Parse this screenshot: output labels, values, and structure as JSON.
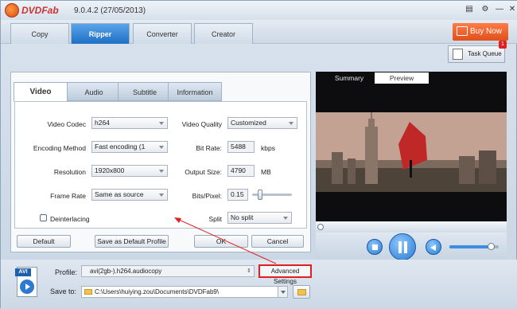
{
  "app": {
    "logo": "DVDFab",
    "version": "9.0.4.2 (27/05/2013)"
  },
  "titlebar_icons": [
    "layout-icon",
    "gear-icon",
    "minimize-icon",
    "close-icon"
  ],
  "nav": {
    "tabs": [
      {
        "label": "Copy",
        "active": false
      },
      {
        "label": "Ripper",
        "active": true
      },
      {
        "label": "Converter",
        "active": false
      },
      {
        "label": "Creator",
        "active": false
      }
    ],
    "buy_now": "Buy Now",
    "task_queue": "Task Queue",
    "task_badge": "1"
  },
  "settings": {
    "tabs": [
      "Video",
      "Audio",
      "Subtitle",
      "Information"
    ],
    "active_tab": "Video",
    "video_codec": {
      "label": "Video Codec",
      "value": "h264"
    },
    "encoding_method": {
      "label": "Encoding Method",
      "value": "Fast encoding (1"
    },
    "resolution": {
      "label": "Resolution",
      "value": "1920x800"
    },
    "frame_rate": {
      "label": "Frame Rate",
      "value": "Same as source"
    },
    "video_quality": {
      "label": "Video Quality",
      "value": "Customized"
    },
    "bit_rate": {
      "label": "Bit Rate:",
      "value": "5488",
      "unit": "kbps"
    },
    "output_size": {
      "label": "Output Size:",
      "value": "4790",
      "unit": "MB"
    },
    "bits_pixel": {
      "label": "Bits/Pixel:",
      "value": "0.15",
      "slider_level": 0.15
    },
    "deinterlacing": {
      "label": "Deinterlacing",
      "checked": false
    },
    "split": {
      "label": "Split",
      "value": "No split"
    },
    "buttons": {
      "default": "Default",
      "save_default": "Save as Default Profile",
      "ok": "OK",
      "cancel": "Cancel"
    }
  },
  "preview": {
    "tabs": [
      "Summary",
      "Preview"
    ],
    "active_tab": "Preview",
    "volume_level": 0.85
  },
  "bottom": {
    "profile_label": "Profile:",
    "profile_value": "avi(2gb-).h264.audiocopy",
    "advanced_settings": "Advanced Settings",
    "save_to_label": "Save to:",
    "save_to_value": "C:\\Users\\huiying.zou\\Documents\\DVDFab9\\",
    "format_icon_text": "AVI"
  },
  "colors": {
    "accent_blue": "#1e6fc6",
    "buy_orange": "#e0501c",
    "highlight_red": "#e02020"
  }
}
